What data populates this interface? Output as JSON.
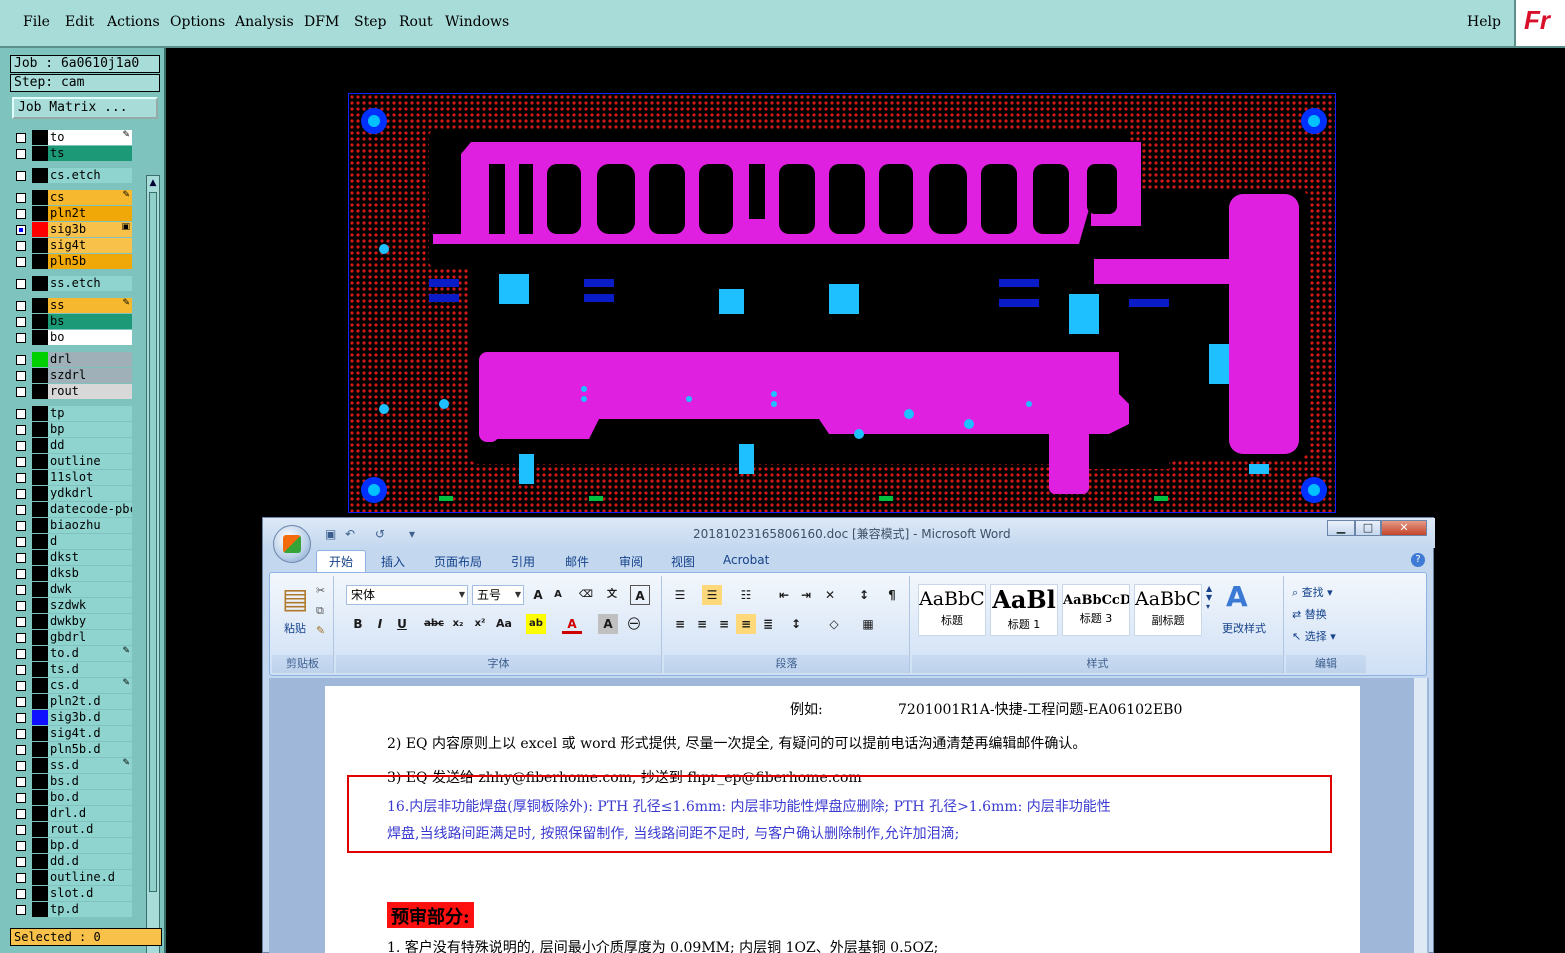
{
  "menubar": {
    "items": [
      "File",
      "Edit",
      "Actions",
      "Options",
      "Analysis",
      "DFM",
      "Step",
      "Rout",
      "Windows"
    ],
    "help": "Help",
    "logo": "Fr"
  },
  "job": {
    "job_line": "Job : 6a0610j1a0",
    "step_line": "Step: cam",
    "matrix_button": "Job Matrix ...",
    "selected": "Selected : 0"
  },
  "layers": [
    {
      "name": "to",
      "color": "#ffffff",
      "swatch": "#000000",
      "mark": "✎"
    },
    {
      "name": "ts",
      "color": "#1c9a78",
      "swatch": "#000000",
      "mark": ""
    },
    {
      "name": "cs.etch",
      "color": "#8fd4cf",
      "swatch": "#000000",
      "mark": ""
    },
    {
      "name": "cs",
      "color": "#f5b82e",
      "swatch": "#000000",
      "mark": "✎"
    },
    {
      "name": "pln2t",
      "color": "#f0a808",
      "swatch": "#000000",
      "mark": ""
    },
    {
      "name": "sig3b",
      "color": "#f8c24a",
      "swatch": "#ff0000",
      "mark": "▣",
      "checked": true
    },
    {
      "name": "sig4t",
      "color": "#f8c24a",
      "swatch": "#000000",
      "mark": ""
    },
    {
      "name": "pln5b",
      "color": "#f0a808",
      "swatch": "#000000",
      "mark": ""
    },
    {
      "name": "ss.etch",
      "color": "#8fd4cf",
      "swatch": "#000000",
      "mark": ""
    },
    {
      "name": "ss",
      "color": "#f5b82e",
      "swatch": "#000000",
      "mark": "✎"
    },
    {
      "name": "bs",
      "color": "#1c9a78",
      "swatch": "#000000",
      "mark": ""
    },
    {
      "name": "bo",
      "color": "#ffffff",
      "swatch": "#000000",
      "mark": ""
    },
    {
      "name": "drl",
      "color": "#9fb0b8",
      "swatch": "#00d000",
      "mark": ""
    },
    {
      "name": "szdrl",
      "color": "#9fb0b8",
      "swatch": "#000000",
      "mark": ""
    },
    {
      "name": "rout",
      "color": "#d8d8d8",
      "swatch": "#000000",
      "mark": ""
    },
    {
      "name": "tp",
      "color": "#8fd4cf",
      "swatch": "#000000",
      "mark": ""
    },
    {
      "name": "bp",
      "color": "#8fd4cf",
      "swatch": "#000000",
      "mark": ""
    },
    {
      "name": "dd",
      "color": "#8fd4cf",
      "swatch": "#000000",
      "mark": ""
    },
    {
      "name": "outline",
      "color": "#8fd4cf",
      "swatch": "#000000",
      "mark": ""
    },
    {
      "name": "11slot",
      "color": "#8fd4cf",
      "swatch": "#000000",
      "mark": ""
    },
    {
      "name": "ydkdrl",
      "color": "#8fd4cf",
      "swatch": "#000000",
      "mark": ""
    },
    {
      "name": "datecode-pbc",
      "color": "#8fd4cf",
      "swatch": "#000000",
      "mark": ""
    },
    {
      "name": "biaozhu",
      "color": "#8fd4cf",
      "swatch": "#000000",
      "mark": ""
    },
    {
      "name": "d",
      "color": "#8fd4cf",
      "swatch": "#000000",
      "mark": ""
    },
    {
      "name": "dkst",
      "color": "#8fd4cf",
      "swatch": "#000000",
      "mark": ""
    },
    {
      "name": "dksb",
      "color": "#8fd4cf",
      "swatch": "#000000",
      "mark": ""
    },
    {
      "name": "dwk",
      "color": "#8fd4cf",
      "swatch": "#000000",
      "mark": ""
    },
    {
      "name": "szdwk",
      "color": "#8fd4cf",
      "swatch": "#000000",
      "mark": ""
    },
    {
      "name": "dwkby",
      "color": "#8fd4cf",
      "swatch": "#000000",
      "mark": ""
    },
    {
      "name": "gbdrl",
      "color": "#8fd4cf",
      "swatch": "#000000",
      "mark": ""
    },
    {
      "name": "to.d",
      "color": "#8fd4cf",
      "swatch": "#000000",
      "mark": "✎"
    },
    {
      "name": "ts.d",
      "color": "#8fd4cf",
      "swatch": "#000000",
      "mark": ""
    },
    {
      "name": "cs.d",
      "color": "#8fd4cf",
      "swatch": "#000000",
      "mark": "✎"
    },
    {
      "name": "pln2t.d",
      "color": "#8fd4cf",
      "swatch": "#000000",
      "mark": ""
    },
    {
      "name": "sig3b.d",
      "color": "#8fd4cf",
      "swatch": "#1010ff",
      "mark": ""
    },
    {
      "name": "sig4t.d",
      "color": "#8fd4cf",
      "swatch": "#000000",
      "mark": ""
    },
    {
      "name": "pln5b.d",
      "color": "#8fd4cf",
      "swatch": "#000000",
      "mark": ""
    },
    {
      "name": "ss.d",
      "color": "#8fd4cf",
      "swatch": "#000000",
      "mark": "✎"
    },
    {
      "name": "bs.d",
      "color": "#8fd4cf",
      "swatch": "#000000",
      "mark": ""
    },
    {
      "name": "bo.d",
      "color": "#8fd4cf",
      "swatch": "#000000",
      "mark": ""
    },
    {
      "name": "drl.d",
      "color": "#8fd4cf",
      "swatch": "#000000",
      "mark": ""
    },
    {
      "name": "rout.d",
      "color": "#8fd4cf",
      "swatch": "#000000",
      "mark": ""
    },
    {
      "name": "bp.d",
      "color": "#8fd4cf",
      "swatch": "#000000",
      "mark": ""
    },
    {
      "name": "dd.d",
      "color": "#8fd4cf",
      "swatch": "#000000",
      "mark": ""
    },
    {
      "name": "outline.d",
      "color": "#8fd4cf",
      "swatch": "#000000",
      "mark": ""
    },
    {
      "name": "slot.d",
      "color": "#8fd4cf",
      "swatch": "#000000",
      "mark": ""
    },
    {
      "name": "tp.d",
      "color": "#8fd4cf",
      "swatch": "#000000",
      "mark": ""
    }
  ],
  "pcb": {
    "trace_color": "#e020e0",
    "pad_color": "#1e90ff",
    "dot_color": "#d01818",
    "fiducial_color": "#0030ff"
  },
  "word": {
    "title": "20181023165806160.doc [兼容模式] - Microsoft Word",
    "tabs": [
      "开始",
      "插入",
      "页面布局",
      "引用",
      "邮件",
      "审阅",
      "视图",
      "Acrobat"
    ],
    "clipboard": {
      "paste": "粘贴",
      "group": "剪贴板"
    },
    "font": {
      "name": "宋体",
      "size": "五号",
      "group": "字体"
    },
    "paragraph": {
      "group": "段落"
    },
    "styles": {
      "items": [
        {
          "preview": "AaBbC(",
          "name": "标题"
        },
        {
          "preview": "AaBl",
          "name": "标题 1"
        },
        {
          "preview": "AaBbCcD(",
          "name": "标题 3"
        },
        {
          "preview": "AaBbC(",
          "name": "副标题"
        }
      ],
      "change": "更改样式",
      "group": "样式"
    },
    "editing": {
      "find": "查找",
      "replace": "替换",
      "select": "选择",
      "group": "编辑"
    },
    "doc": {
      "example_label": "例如:",
      "example_value": "7201001R1A-快捷-工程问题-EA06102EB0",
      "line2": "2) EQ 内容原则上以 excel 或 word 形式提供, 尽量一次提全, 有疑问的可以提前电话沟通清楚再编辑邮件确认。",
      "line3": "3) EQ 发送给 zhhy@fiberhome.com, 抄送到 fhpr_ep@fiberhome.com",
      "item16a": "16.内层非功能焊盘(厚铜板除外): PTH 孔径≤1.6mm: 内层非功能性焊盘应删除; PTH 孔径>1.6mm: 内层非功能性",
      "item16b": "焊盘,当线路间距满足时, 按照保留制作, 当线路间距不足时, 与客户确认删除制作,允许加泪滴;",
      "heading": "预审部分:",
      "line_last": "1.   客户没有特殊说明的, 层间最小介质厚度为 0.09MM; 内层铜 1OZ、外层基铜 0.5OZ;"
    }
  }
}
